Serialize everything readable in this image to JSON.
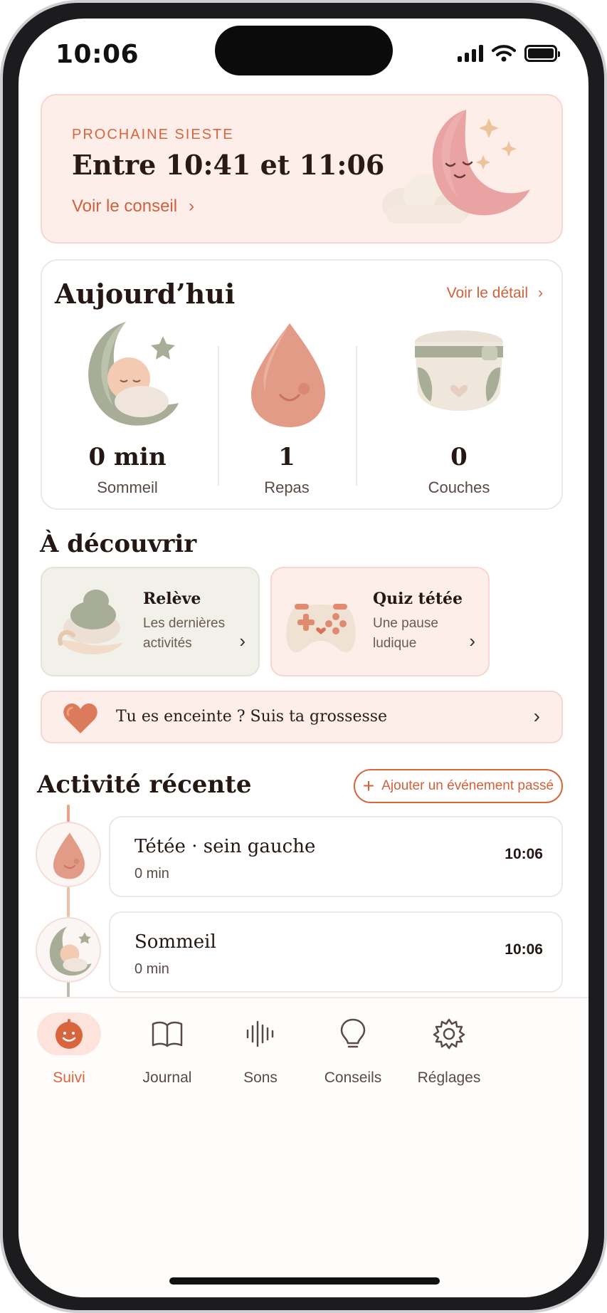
{
  "status_bar": {
    "time": "10:06"
  },
  "hero": {
    "kicker": "PROCHAINE SIESTE",
    "title": "Entre 10:41 et 11:06",
    "link": "Voir le conseil"
  },
  "today": {
    "title": "Aujourd’hui",
    "link": "Voir le détail",
    "stats": [
      {
        "value": "0 min",
        "label": "Sommeil",
        "icon": "baby-moon-icon"
      },
      {
        "value": "1",
        "label": "Repas",
        "icon": "drop-icon"
      },
      {
        "value": "0",
        "label": "Couches",
        "icon": "diaper-icon"
      }
    ]
  },
  "discover": {
    "title": "À découvrir",
    "cards": [
      {
        "title": "Relève",
        "subtitle": "Les dernières activités",
        "icon": "hands-baby-icon"
      },
      {
        "title": "Quiz tétée",
        "subtitle": "Une pause ludique",
        "icon": "gamepad-icon"
      }
    ]
  },
  "pregnancy_banner": {
    "text": "Tu es enceinte ? Suis ta grossesse",
    "icon": "heart-icon"
  },
  "recent": {
    "title": "Activité récente",
    "add_button": "Ajouter un événement passé",
    "items": [
      {
        "title": "Tétée · sein gauche",
        "duration": "0 min",
        "time": "10:06",
        "icon": "drop-icon"
      },
      {
        "title": "Sommeil",
        "duration": "0 min",
        "time": "10:06",
        "icon": "baby-moon-icon"
      }
    ]
  },
  "tabs": [
    {
      "label": "Suivi",
      "icon": "smile-icon",
      "active": true
    },
    {
      "label": "Journal",
      "icon": "book-icon",
      "active": false
    },
    {
      "label": "Sons",
      "icon": "sound-wave-icon",
      "active": false
    },
    {
      "label": "Conseils",
      "icon": "lightbulb-icon",
      "active": false
    },
    {
      "label": "Réglages",
      "icon": "gear-icon",
      "active": false
    }
  ],
  "colors": {
    "accent": "#d9653f",
    "pink_bg": "#fdeeea",
    "sage_bg": "#f1f1ea",
    "text": "#241714"
  }
}
